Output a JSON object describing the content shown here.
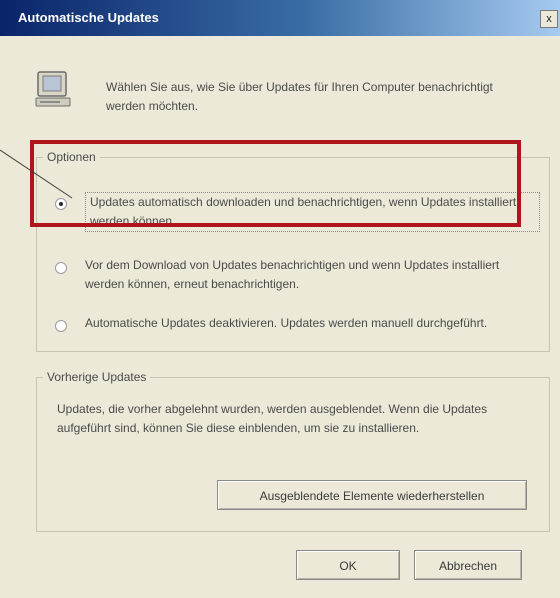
{
  "window": {
    "title": "Automatische Updates",
    "close_label": "x"
  },
  "intro": {
    "icon": "monitor-icon",
    "text": "Wählen Sie aus, wie Sie über Updates für Ihren Computer benachrichtigt werden möchten."
  },
  "options": {
    "legend": "Optionen",
    "items": [
      {
        "label": "Updates automatisch downloaden und benachrichtigen, wenn Updates installiert werden können.",
        "selected": true
      },
      {
        "label": "Vor dem Download von Updates benachrichtigen und wenn Updates installiert werden können, erneut benachrichtigen.",
        "selected": false
      },
      {
        "label": "Automatische Updates deaktivieren. Updates werden manuell durchgeführt.",
        "selected": false
      }
    ]
  },
  "previous": {
    "legend": "Vorherige Updates",
    "text": "Updates, die vorher abgelehnt wurden, werden ausgeblendet. Wenn die Updates aufgeführt sind, können Sie diese einblenden, um sie zu installieren.",
    "restore_button": "Ausgeblendete Elemente wiederherstellen"
  },
  "buttons": {
    "ok": "OK",
    "cancel": "Abbrechen"
  },
  "annotation": {
    "highlight_color": "#b0141c"
  }
}
